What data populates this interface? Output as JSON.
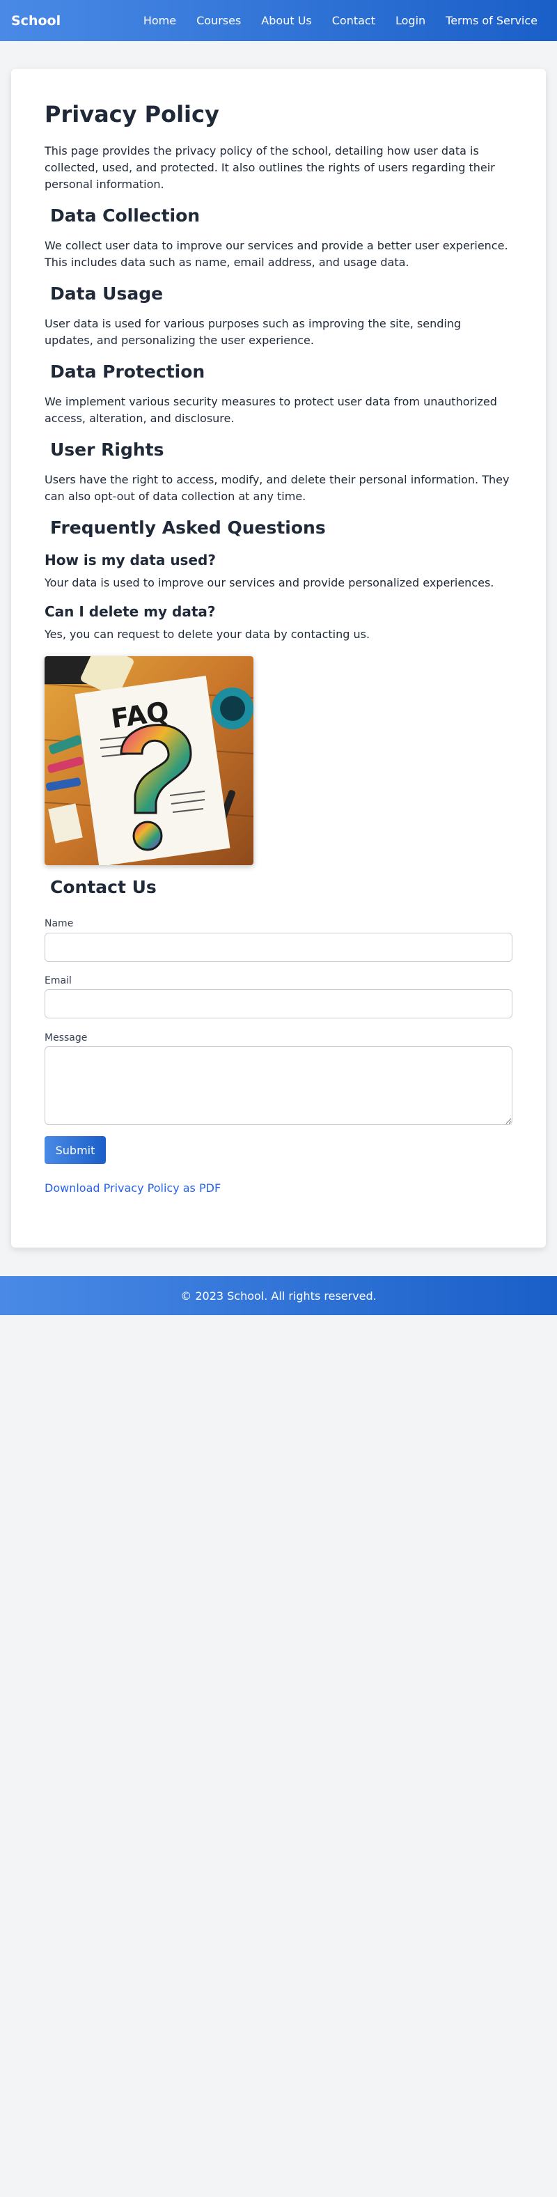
{
  "nav": {
    "brand": "School",
    "links": [
      "Home",
      "Courses",
      "About Us",
      "Contact",
      "Login",
      "Terms of Service"
    ]
  },
  "page": {
    "title": "Privacy Policy",
    "intro": "This page provides the privacy policy of the school, detailing how user data is collected, used, and protected. It also outlines the rights of users regarding their personal information."
  },
  "sections": [
    {
      "heading": "Data Collection",
      "text": "We collect user data to improve our services and provide a better user experience. This includes data such as name, email address, and usage data."
    },
    {
      "heading": "Data Usage",
      "text": "User data is used for various purposes such as improving the site, sending updates, and personalizing the user experience."
    },
    {
      "heading": "Data Protection",
      "text": "We implement various security measures to protect user data from unauthorized access, alteration, and disclosure."
    },
    {
      "heading": "User Rights",
      "text": "Users have the right to access, modify, and delete their personal information. They can also opt-out of data collection at any time."
    }
  ],
  "faq": {
    "heading": "Frequently Asked Questions",
    "items": [
      {
        "q": "How is my data used?",
        "a": "Your data is used to improve our services and provide personalized experiences."
      },
      {
        "q": "Can I delete my data?",
        "a": "Yes, you can request to delete your data by contacting us."
      }
    ],
    "image_text": "FAQ"
  },
  "contact": {
    "heading": "Contact Us",
    "name_label": "Name",
    "email_label": "Email",
    "message_label": "Message",
    "name_value": "",
    "email_value": "",
    "message_value": "",
    "submit_label": "Submit"
  },
  "download_link": "Download Privacy Policy as PDF",
  "footer": "© 2023 School. All rights reserved.",
  "colors": {
    "accent_start": "#4a8ae6",
    "accent_end": "#1a5fc8",
    "link": "#2563eb"
  }
}
